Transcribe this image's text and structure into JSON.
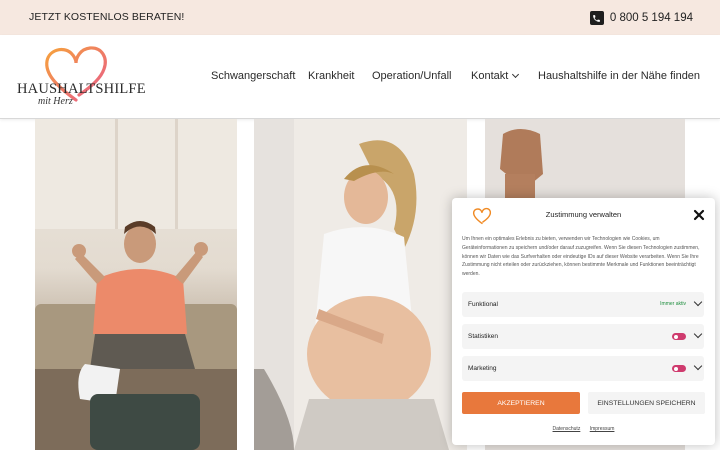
{
  "topbar": {
    "cta": "JETZT KOSTENLOS BERATEN!",
    "phone": "0 800 5 194 194",
    "phone_icon": "phone-icon"
  },
  "logo": {
    "brand": "HAUSHALTSHILFE",
    "tagline": "mit Herz",
    "heart_color": "#f08a24"
  },
  "nav": [
    {
      "label": "Schwangerschaft"
    },
    {
      "label": "Krankheit"
    },
    {
      "label": "Operation/Unfall"
    },
    {
      "label": "Kontakt"
    },
    {
      "label": "Haushaltshilfe in der Nähe finden"
    }
  ],
  "consent": {
    "title": "Zustimmung verwalten",
    "text": "Um Ihnen ein optimales Erlebnis zu bieten, verwenden wir Technologien wie Cookies, um Geräteinformationen zu speichern und/oder darauf zuzugreifen. Wenn Sie diesen Technologien zustimmen, können wir Daten wie das Surfverhalten oder eindeutige IDs auf dieser Website verarbeiten. Wenn Sie Ihre Zustimmung nicht erteilen oder zurückziehen, können bestimmte Merkmale und Funktionen beeinträchtigt werden.",
    "categories": [
      {
        "label": "Funktional",
        "status": "Immer aktiv"
      },
      {
        "label": "Statistiken",
        "enabled": true
      },
      {
        "label": "Marketing",
        "enabled": true
      }
    ],
    "accept": "AKZEPTIEREN",
    "save": "EINSTELLUNGEN SPEICHERN",
    "links": [
      "Datenschutz",
      "Impressum"
    ],
    "accent": "#e8783c",
    "toggle_color": "#cf3b6e"
  },
  "colors": {
    "topbar_bg": "#f6e8e0"
  }
}
